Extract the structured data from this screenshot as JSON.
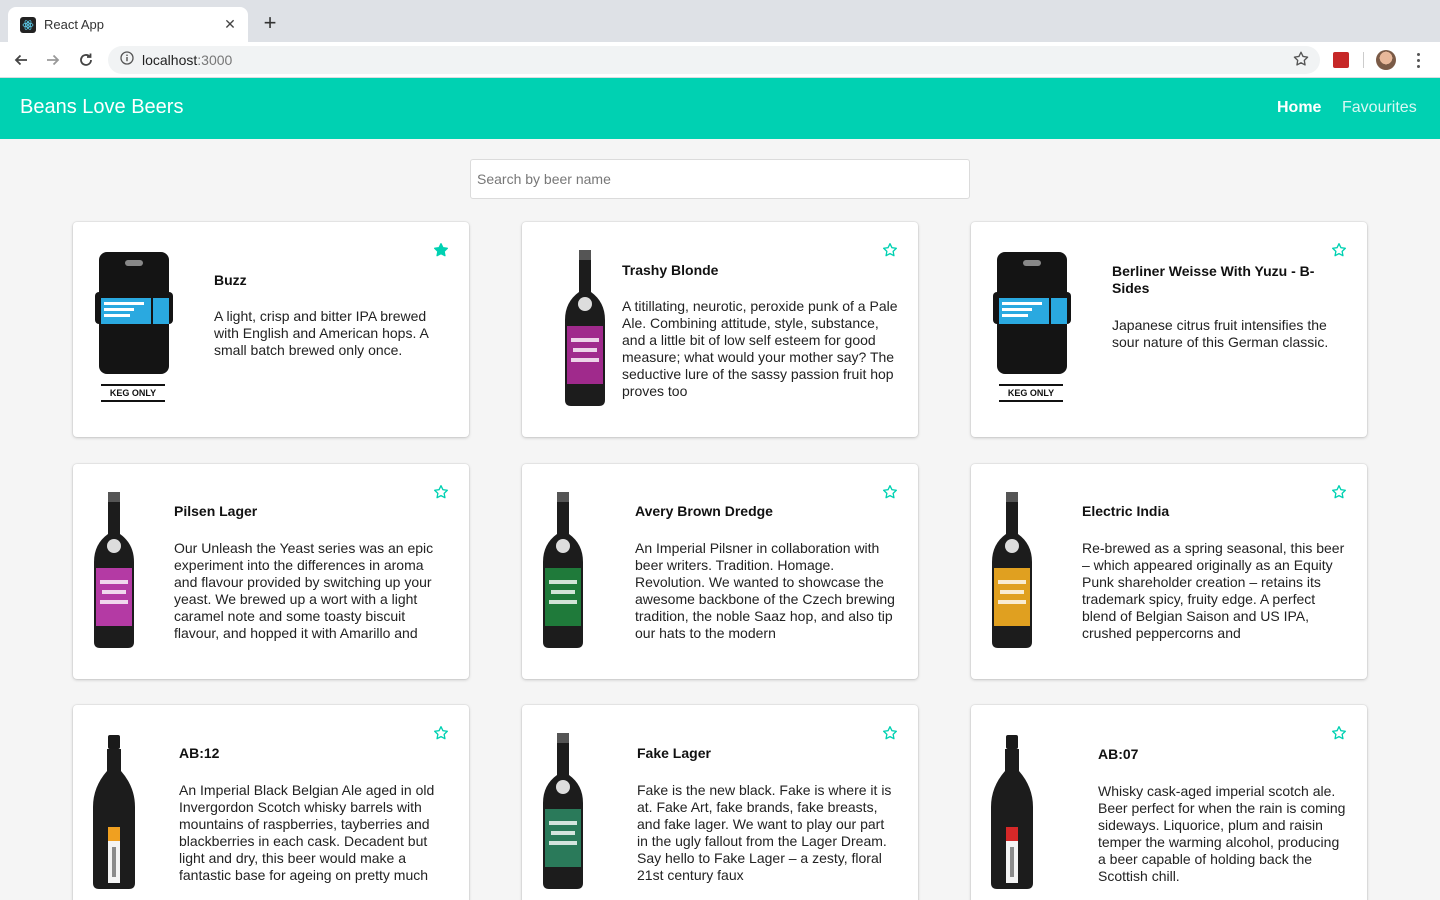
{
  "browser": {
    "tab_title": "React App",
    "url_host": "localhost",
    "url_port": ":3000"
  },
  "app": {
    "brand": "Beans Love Beers",
    "nav": {
      "home": "Home",
      "favourites": "Favourites"
    },
    "accent_color": "#00d1b2"
  },
  "search": {
    "placeholder": "Search by beer name",
    "value": ""
  },
  "beers": [
    {
      "name": "Buzz",
      "description": "A light, crisp and bitter IPA brewed with English and American hops. A small batch brewed only once.",
      "favourite": true,
      "image": "keg-icon"
    },
    {
      "name": "Trashy Blonde",
      "description": "A titillating, neurotic, peroxide punk of a Pale Ale. Combining attitude, style, substance, and a little bit of low self esteem for good measure; what would your mother say? The seductive lure of the sassy passion fruit hop proves too",
      "favourite": false,
      "image": "beer-bottle-icon",
      "label_color": "#a02a8c"
    },
    {
      "name": "Berliner Weisse With Yuzu - B-Sides",
      "description": "Japanese citrus fruit intensifies the sour nature of this German classic.",
      "favourite": false,
      "image": "keg-icon"
    },
    {
      "name": "Pilsen Lager",
      "description": "Our Unleash the Yeast series was an epic experiment into the differences in aroma and flavour provided by switching up your yeast. We brewed up a wort with a light caramel note and some toasty biscuit flavour, and hopped it with Amarillo and",
      "favourite": false,
      "image": "beer-bottle-icon",
      "label_color": "#b43aa4"
    },
    {
      "name": "Avery Brown Dredge",
      "description": "An Imperial Pilsner in collaboration with beer writers. Tradition. Homage. Revolution. We wanted to showcase the awesome backbone of the Czech brewing tradition, the noble Saaz hop, and also tip our hats to the modern",
      "favourite": false,
      "image": "beer-bottle-icon",
      "label_color": "#1f7a3a"
    },
    {
      "name": "Electric India",
      "description": "Re-brewed as a spring seasonal, this beer – which appeared originally as an Equity Punk shareholder creation – retains its trademark spicy, fruity edge. A perfect blend of Belgian Saison and US IPA, crushed peppercorns and",
      "favourite": false,
      "image": "beer-bottle-icon",
      "label_color": "#e0a020"
    },
    {
      "name": "AB:12",
      "description": "An Imperial Black Belgian Ale aged in old Invergordon Scotch whisky barrels with mountains of raspberries, tayberries and blackberries in each cask. Decadent but light and dry, this beer would make a fantastic base for ageing on pretty much",
      "favourite": false,
      "image": "wine-bottle-icon",
      "label_color": "#f0a020"
    },
    {
      "name": "Fake Lager",
      "description": "Fake is the new black. Fake is where it is at. Fake Art, fake brands, fake breasts, and fake lager. We want to play our part in the ugly fallout from the Lager Dream. Say hello to Fake Lager – a zesty, floral 21st century faux",
      "favourite": false,
      "image": "beer-bottle-icon",
      "label_color": "#2a7a5a"
    },
    {
      "name": "AB:07",
      "description": "Whisky cask-aged imperial scotch ale. Beer perfect for when the rain is coming sideways. Liquorice, plum and raisin temper the warming alcohol, producing a beer capable of holding back the Scottish chill.",
      "favourite": false,
      "image": "wine-bottle-icon",
      "label_color": "#d62828"
    }
  ]
}
